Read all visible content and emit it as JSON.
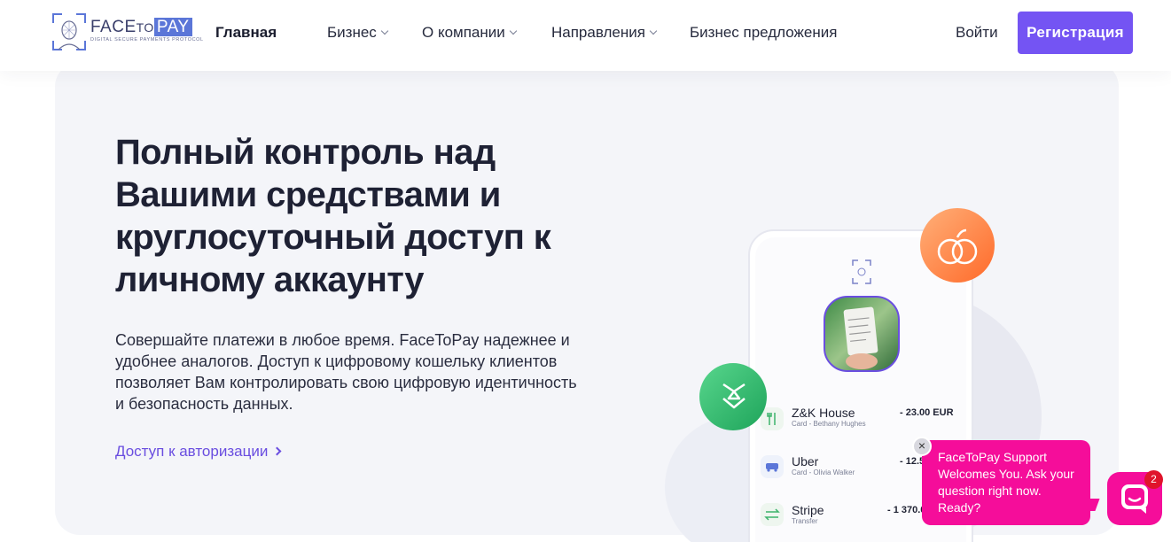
{
  "header": {
    "logo": {
      "brand_face": "FACE",
      "brand_to": "TO",
      "brand_pay": "PAY",
      "tagline": "DIGITAL SECURE PAYMENTS PROTOCOL"
    },
    "nav": [
      {
        "label": "Главная",
        "active": true
      },
      {
        "label": "Бизнес",
        "dropdown": true
      },
      {
        "label": "О компании",
        "dropdown": true
      },
      {
        "label": "Направления",
        "dropdown": true
      },
      {
        "label": "Бизнес предложения",
        "dropdown": false
      }
    ],
    "login_label": "Войти",
    "register_label": "Регистрация"
  },
  "hero": {
    "headline": "Полный контроль над Вашими средствами и круглосуточный доступ к личному аккаунту",
    "paragraph": "Совершайте платежи в любое время. FaceToPay надежнее и удобнее аналогов. Доступ к цифровому кошельку клиентов позволяет Вам контролировать свою цифровую идентичность и безопасность данных.",
    "cta_label": "Доступ к авторизации"
  },
  "phone": {
    "transactions": [
      {
        "name": "Z&K House",
        "detail": "Card - Bethany Hughes",
        "amount": "- 23.00 EUR"
      },
      {
        "name": "Uber",
        "detail": "Card - Olivia Walker",
        "amount": "- 12.5"
      },
      {
        "name": "Stripe",
        "detail": "Transfer",
        "amount": "- 1 370.0"
      }
    ]
  },
  "chat": {
    "message": "FaceToPay Support Welcomes You. Ask your question right now. Ready?",
    "close_label": "×",
    "unread_count": "2"
  },
  "colors": {
    "accent": "#7454f3",
    "link": "#6a4ee0",
    "chat": "#f50d9a",
    "badge": "#e0142b",
    "hero_bg": "#f4f5f9"
  }
}
